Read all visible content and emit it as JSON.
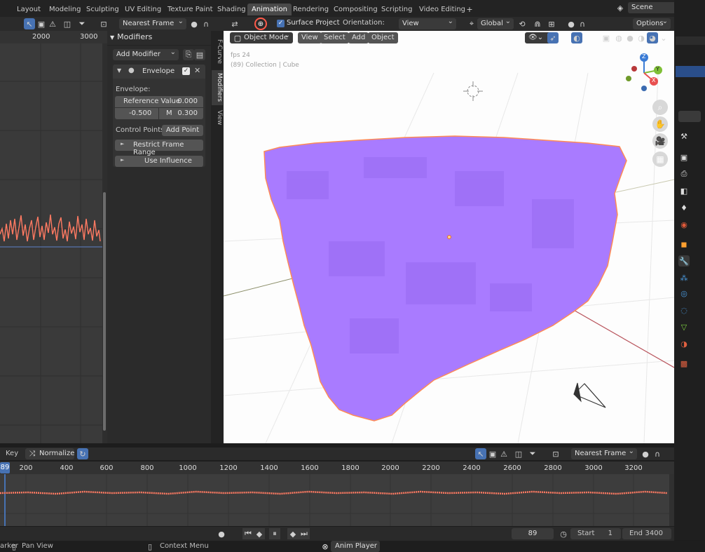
{
  "workspaces": [
    "Layout",
    "Modeling",
    "Sculpting",
    "UV Editing",
    "Texture Paint",
    "Shading",
    "Animation",
    "Rendering",
    "Compositing",
    "Scripting",
    "Video Editing"
  ],
  "active_workspace": "Animation",
  "scene": "Scene",
  "graph_header": {
    "snap_mode": "Nearest Frame"
  },
  "graph_ruler": [
    "2000",
    "3000"
  ],
  "npanel": {
    "title": "Modifiers",
    "add_modifier": "Add Modifier",
    "modifier_name": "Envelope",
    "section_label": "Envelope:",
    "reference_label": "Reference Value",
    "reference_value": "0.000",
    "min_value": "-0.500",
    "max_label": "M",
    "max_value": "0.300",
    "control_points_label": "Control Points:",
    "add_point": "Add Point",
    "restrict_frame_range": "Restrict Frame Range",
    "use_influence": "Use Influence"
  },
  "side_tabs": [
    "F-Curve",
    "Modifiers",
    "View"
  ],
  "viewport_header": {
    "mode": "Object Mode",
    "menus": [
      "View",
      "Select",
      "Add",
      "Object"
    ],
    "surface_project": "Surface Project",
    "orientation_label": "Orientation:",
    "orientation_value": "View",
    "transform_space": "Global",
    "options": "Options"
  },
  "viewport_overlay": {
    "frame": "fps 24",
    "collection": "(89) Collection | Cube"
  },
  "gizmo": {
    "x": "X",
    "y": "Y",
    "z": "Z"
  },
  "timeline_header": {
    "key": "Key",
    "normalize": "Normalize",
    "snap_mode": "Nearest Frame"
  },
  "timeline_ruler": [
    "89",
    "200",
    "400",
    "600",
    "800",
    "1000",
    "1200",
    "1400",
    "1600",
    "1800",
    "2000",
    "2200",
    "2400",
    "2600",
    "2800",
    "3000",
    "3200"
  ],
  "playback": {
    "current_frame": "89",
    "start_label": "Start",
    "start": "1",
    "end_label": "End",
    "end": "3400"
  },
  "status": {
    "left_text": "arker",
    "pan": "Pan View",
    "context": "Context Menu",
    "player": "Anim Player"
  },
  "colors": {
    "accent": "#4772b3",
    "curve": "#ff7a62",
    "mesh": "#a97bff",
    "mesh_outline": "#ff8a55",
    "active_tab": "#4a4a4a"
  }
}
